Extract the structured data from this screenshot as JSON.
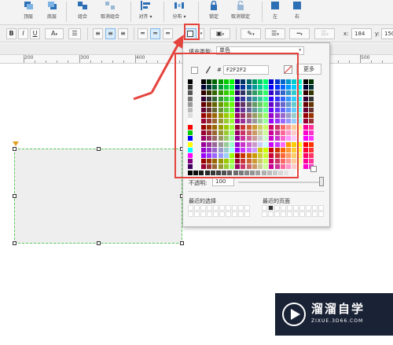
{
  "toolbar1": {
    "buttons": [
      {
        "label": "顶层"
      },
      {
        "label": "底层"
      },
      {
        "label": "组合"
      },
      {
        "label": "取消组合"
      },
      {
        "label": "对齐 ▾"
      },
      {
        "label": "分布 ▾"
      },
      {
        "label": "锁定"
      },
      {
        "label": "取消锁定"
      },
      {
        "label": "左"
      },
      {
        "label": "右"
      }
    ]
  },
  "toolbar2": {
    "bold": "B",
    "italic": "I",
    "underline": "U",
    "text_color": "A",
    "x_label": "x:",
    "x_value": "184",
    "y_label": "y:",
    "y_value": "150"
  },
  "ruler": {
    "labels": [
      "200",
      "300",
      "400",
      "500"
    ]
  },
  "fill_popup": {
    "fill_type_label": "填充类型:",
    "fill_type_value": "单色",
    "hash": "#",
    "hex_value": "F2F2F2",
    "more_button": "更多",
    "opacity_label": "不透明:",
    "opacity_value": "100",
    "recent_selection_label": "最近的选择",
    "recent_page_label": "最近的页面"
  },
  "watermark": {
    "title": "溜溜自学",
    "url": "ZIXUE.3D66.COM"
  },
  "colors": {
    "annotation_red": "#e5433d",
    "selection_green": "#57c957",
    "shape_fill": "#eeeeee",
    "active_blue": "#d9ecfb"
  }
}
